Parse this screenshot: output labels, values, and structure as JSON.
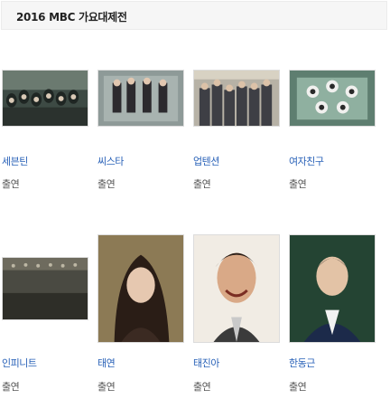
{
  "header": {
    "title": "2016 MBC 가요대제전"
  },
  "cast": [
    {
      "name": "세븐틴",
      "role": "출연",
      "image": "group-photo"
    },
    {
      "name": "씨스타",
      "role": "출연",
      "image": "group-photo"
    },
    {
      "name": "업텐션",
      "role": "출연",
      "image": "group-photo"
    },
    {
      "name": "여자친구",
      "role": "출연",
      "image": "group-photo"
    },
    {
      "name": "인피니트",
      "role": "출연",
      "image": "group-photo"
    },
    {
      "name": "태연",
      "role": "출연",
      "image": "portrait-photo"
    },
    {
      "name": "태진아",
      "role": "출연",
      "image": "portrait-photo"
    },
    {
      "name": "한동근",
      "role": "출연",
      "image": "portrait-photo"
    }
  ]
}
